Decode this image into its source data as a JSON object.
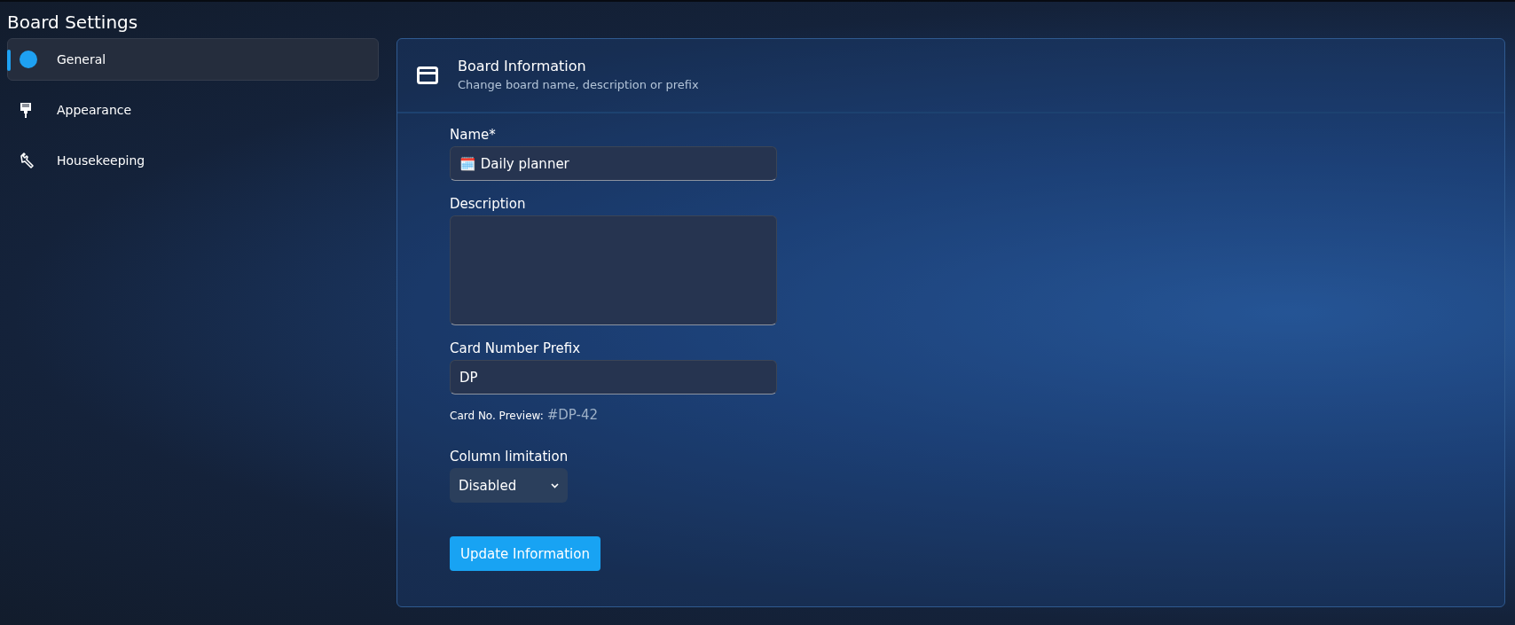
{
  "page_title": "Board Settings",
  "sidebar": {
    "items": [
      {
        "label": "General",
        "kind": "dot",
        "selected": true
      },
      {
        "label": "Appearance",
        "kind": "brush",
        "selected": false
      },
      {
        "label": "Housekeeping",
        "kind": "wrench",
        "selected": false
      }
    ]
  },
  "card": {
    "title": "Board Information",
    "subtitle": "Change board name, description or prefix",
    "fields": [
      {
        "kind": "input",
        "label": "Name*",
        "value": "🗓️ Daily planner"
      },
      {
        "kind": "textarea",
        "label": "Description"
      },
      {
        "kind": "input",
        "label": "Card Number Prefix",
        "value": "DP"
      },
      {
        "kind": "preview",
        "label": "Card No. Preview:",
        "value": "#DP-42"
      },
      {
        "kind": "select",
        "label": "Column limitation",
        "value": "Disabled"
      }
    ],
    "button": "Update Information"
  }
}
